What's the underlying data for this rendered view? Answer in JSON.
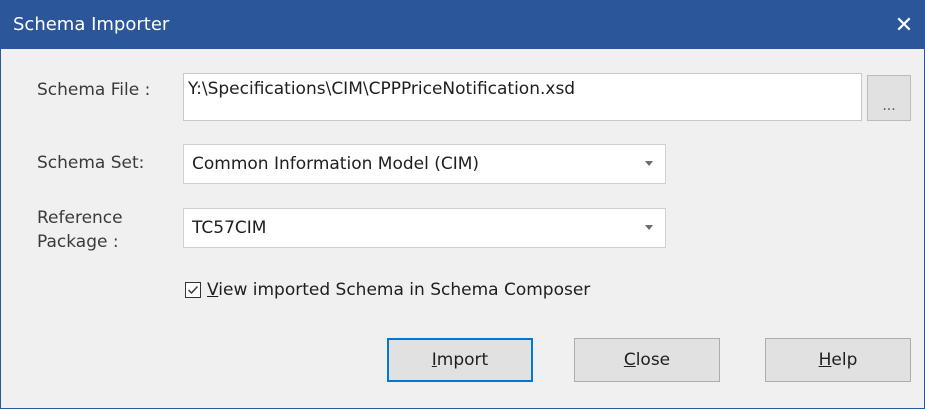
{
  "window": {
    "title": "Schema Importer",
    "close_glyph": "✕"
  },
  "schema_file": {
    "label": "Schema File :",
    "value": "Y:\\Specifications\\CIM\\CPPPriceNotification.xsd",
    "browse_label": "..."
  },
  "schema_set": {
    "label": "Schema Set:",
    "value": "Common Information Model (CIM)"
  },
  "reference_package": {
    "label_line1": "Reference",
    "label_line2": "Package :",
    "value": "TC57CIM"
  },
  "view_checkbox": {
    "checked": true,
    "mnemonic": "V",
    "label_rest": "iew imported Schema in Schema Composer"
  },
  "buttons": {
    "import": {
      "mnemonic": "I",
      "rest": "mport"
    },
    "close": {
      "mnemonic": "C",
      "rest": "lose"
    },
    "help": {
      "mnemonic": "H",
      "rest": "elp"
    }
  },
  "colors": {
    "titlebar": "#2b579a",
    "default_button_border": "#0078d7",
    "dialog_bg": "#f0f0f0"
  }
}
